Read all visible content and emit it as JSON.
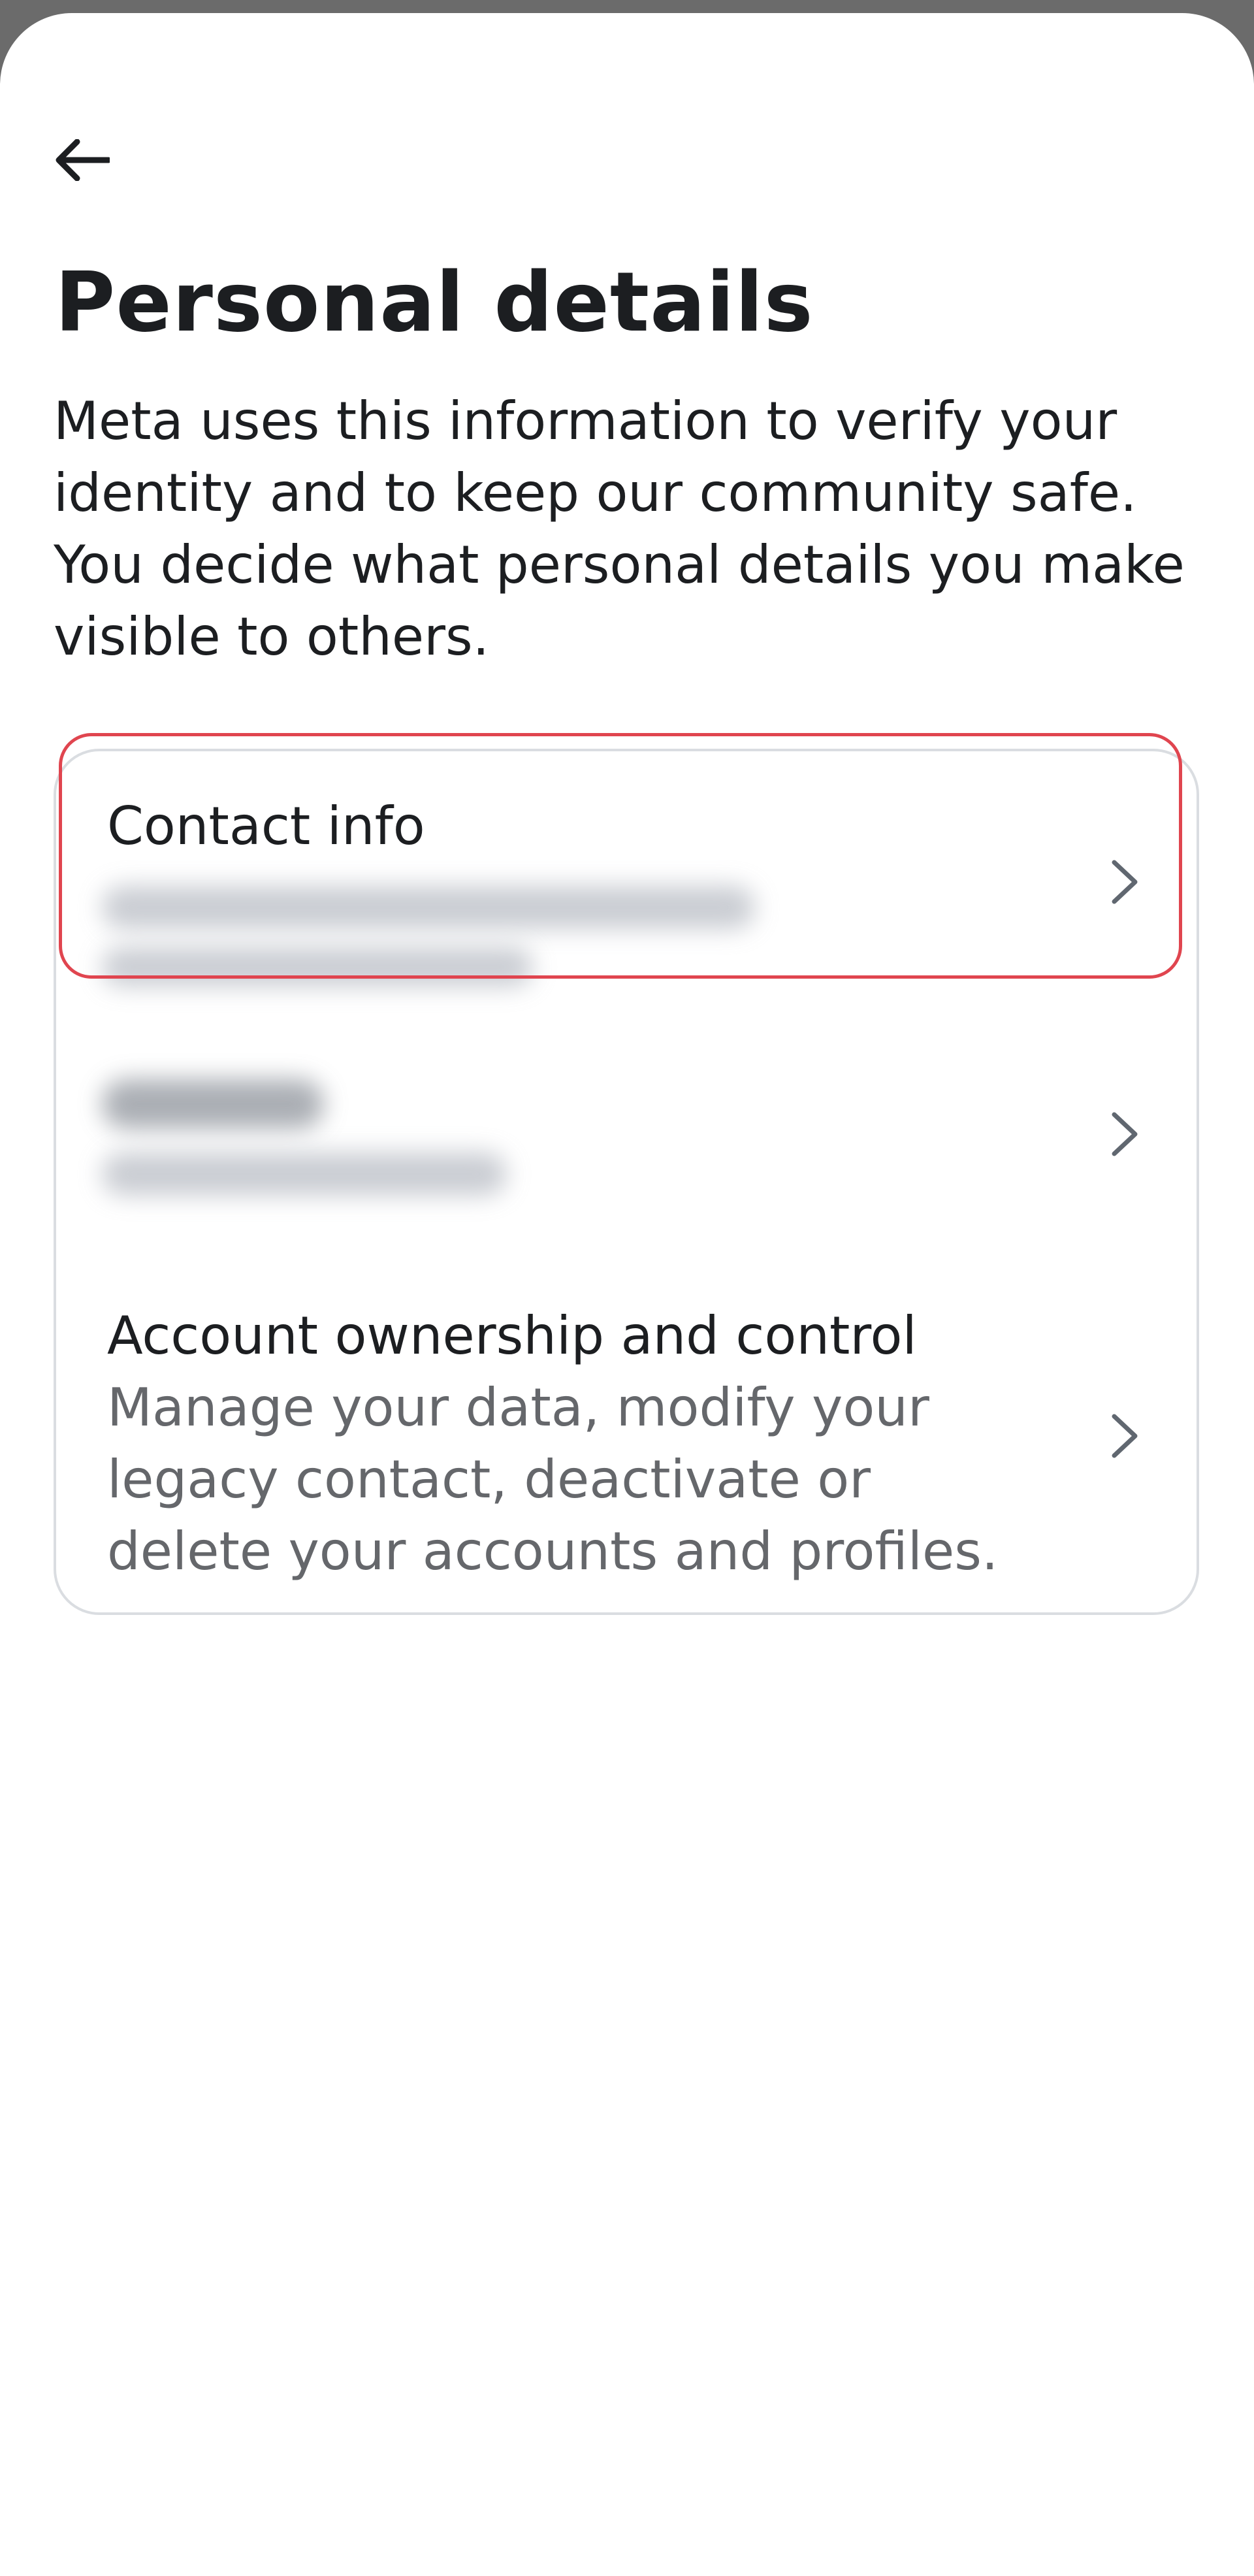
{
  "header": {
    "back_icon": "arrow-left-icon"
  },
  "page": {
    "title": "Personal details",
    "description": "Meta uses this information to verify your identity and to keep our community safe. You decide what personal details you make visible to others."
  },
  "rows": {
    "contact": {
      "title": "Contact info",
      "icon": "chevron-right-icon"
    },
    "birthday": {
      "icon": "chevron-right-icon"
    },
    "ownership": {
      "title": "Account ownership and control",
      "subtitle": "Manage your data, modify your legacy contact, deactivate or delete your accounts and profiles.",
      "icon": "chevron-right-icon"
    }
  },
  "colors": {
    "highlight": "#e0454f",
    "text_primary": "#1c1e21",
    "text_secondary": "#65676b",
    "card_border": "#dadde1"
  }
}
